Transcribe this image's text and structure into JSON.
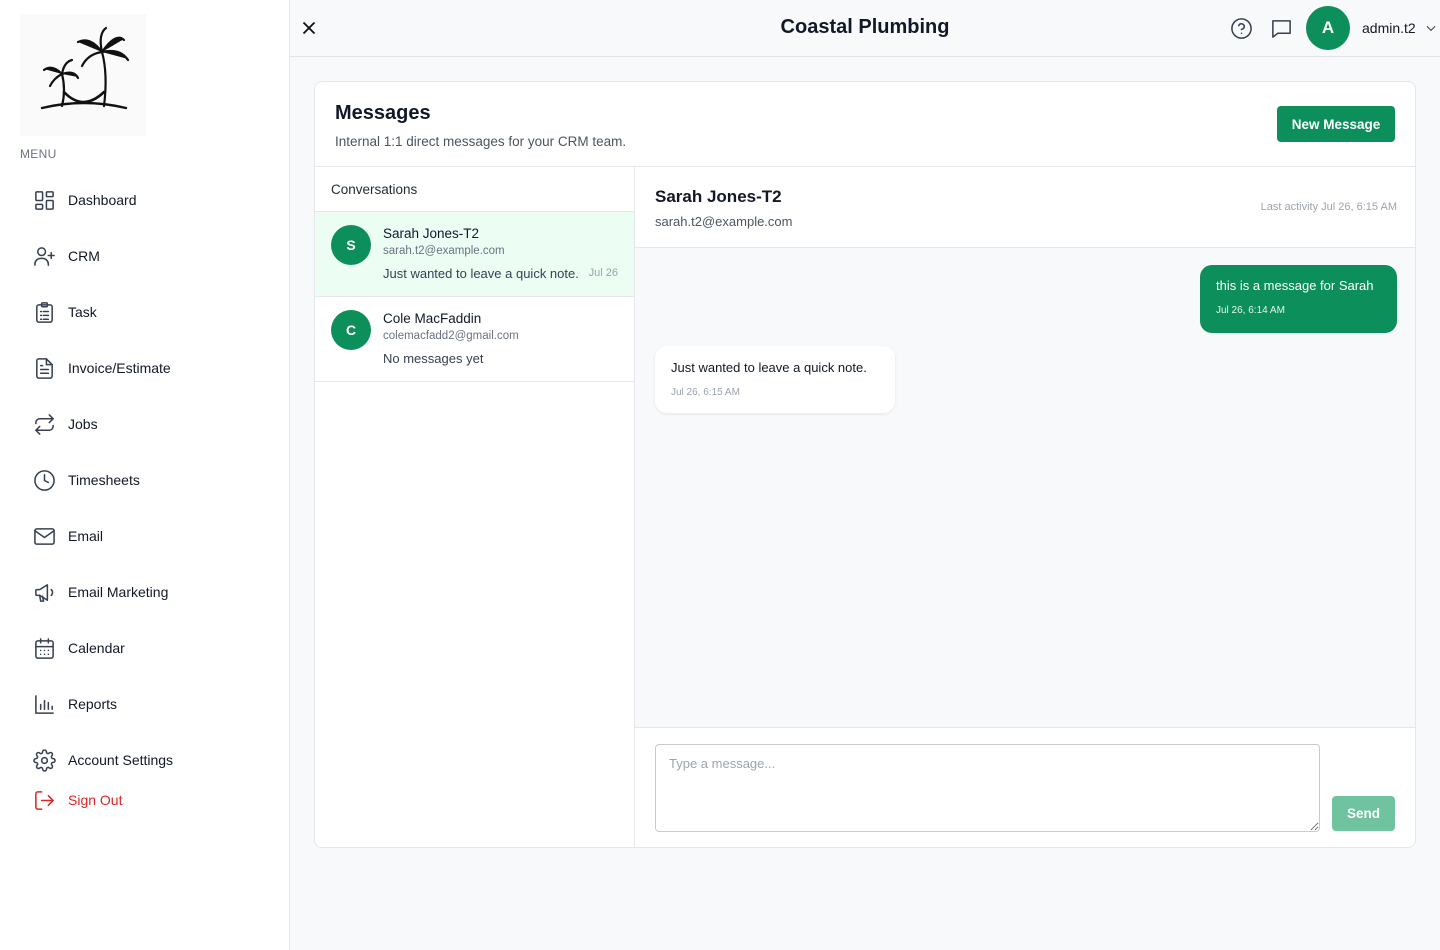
{
  "sidebar": {
    "menu_label": "MENU",
    "items": [
      {
        "label": "Dashboard",
        "icon": "dashboard-icon"
      },
      {
        "label": "CRM",
        "icon": "user-plus-icon"
      },
      {
        "label": "Task",
        "icon": "clipboard-icon"
      },
      {
        "label": "Invoice/Estimate",
        "icon": "document-icon"
      },
      {
        "label": "Jobs",
        "icon": "repeat-icon"
      },
      {
        "label": "Timesheets",
        "icon": "clock-icon"
      },
      {
        "label": "Email",
        "icon": "mail-icon"
      },
      {
        "label": "Email Marketing",
        "icon": "megaphone-icon"
      },
      {
        "label": "Calendar",
        "icon": "calendar-icon"
      },
      {
        "label": "Reports",
        "icon": "bar-chart-icon"
      },
      {
        "label": "Account Settings",
        "icon": "gear-icon"
      },
      {
        "label": "Sign Out",
        "icon": "sign-out-icon"
      }
    ]
  },
  "header": {
    "title": "Coastal Plumbing",
    "avatar_initial": "A",
    "user_name": "admin.t2"
  },
  "messages": {
    "title": "Messages",
    "subtitle": "Internal 1:1 direct messages for your CRM team.",
    "new_message_label": "New Message",
    "conversations_label": "Conversations",
    "conversations": [
      {
        "initial": "S",
        "name": "Sarah Jones-T2",
        "email": "sarah.t2@example.com",
        "preview": "Just wanted to leave a quick note.",
        "date": "Jul 26",
        "active": true
      },
      {
        "initial": "C",
        "name": "Cole MacFaddin",
        "email": "colemacfadd2@gmail.com",
        "preview": "No messages yet",
        "date": "",
        "active": false
      }
    ],
    "thread": {
      "name": "Sarah Jones-T2",
      "email": "sarah.t2@example.com",
      "last_activity": "Last activity Jul 26, 6:15 AM",
      "messages": [
        {
          "direction": "out",
          "text": "this is a message for Sarah",
          "time": "Jul 26, 6:14 AM"
        },
        {
          "direction": "in",
          "text": "Just wanted to leave a quick note.",
          "time": "Jul 26, 6:15 AM"
        }
      ]
    },
    "composer": {
      "placeholder": "Type a message...",
      "value": "",
      "send_label": "Send"
    }
  },
  "colors": {
    "brand_green": "#0c8f5b",
    "send_disabled": "#6fc39f",
    "active_row": "#ecfdf3",
    "sign_out_red": "#dc2626"
  }
}
